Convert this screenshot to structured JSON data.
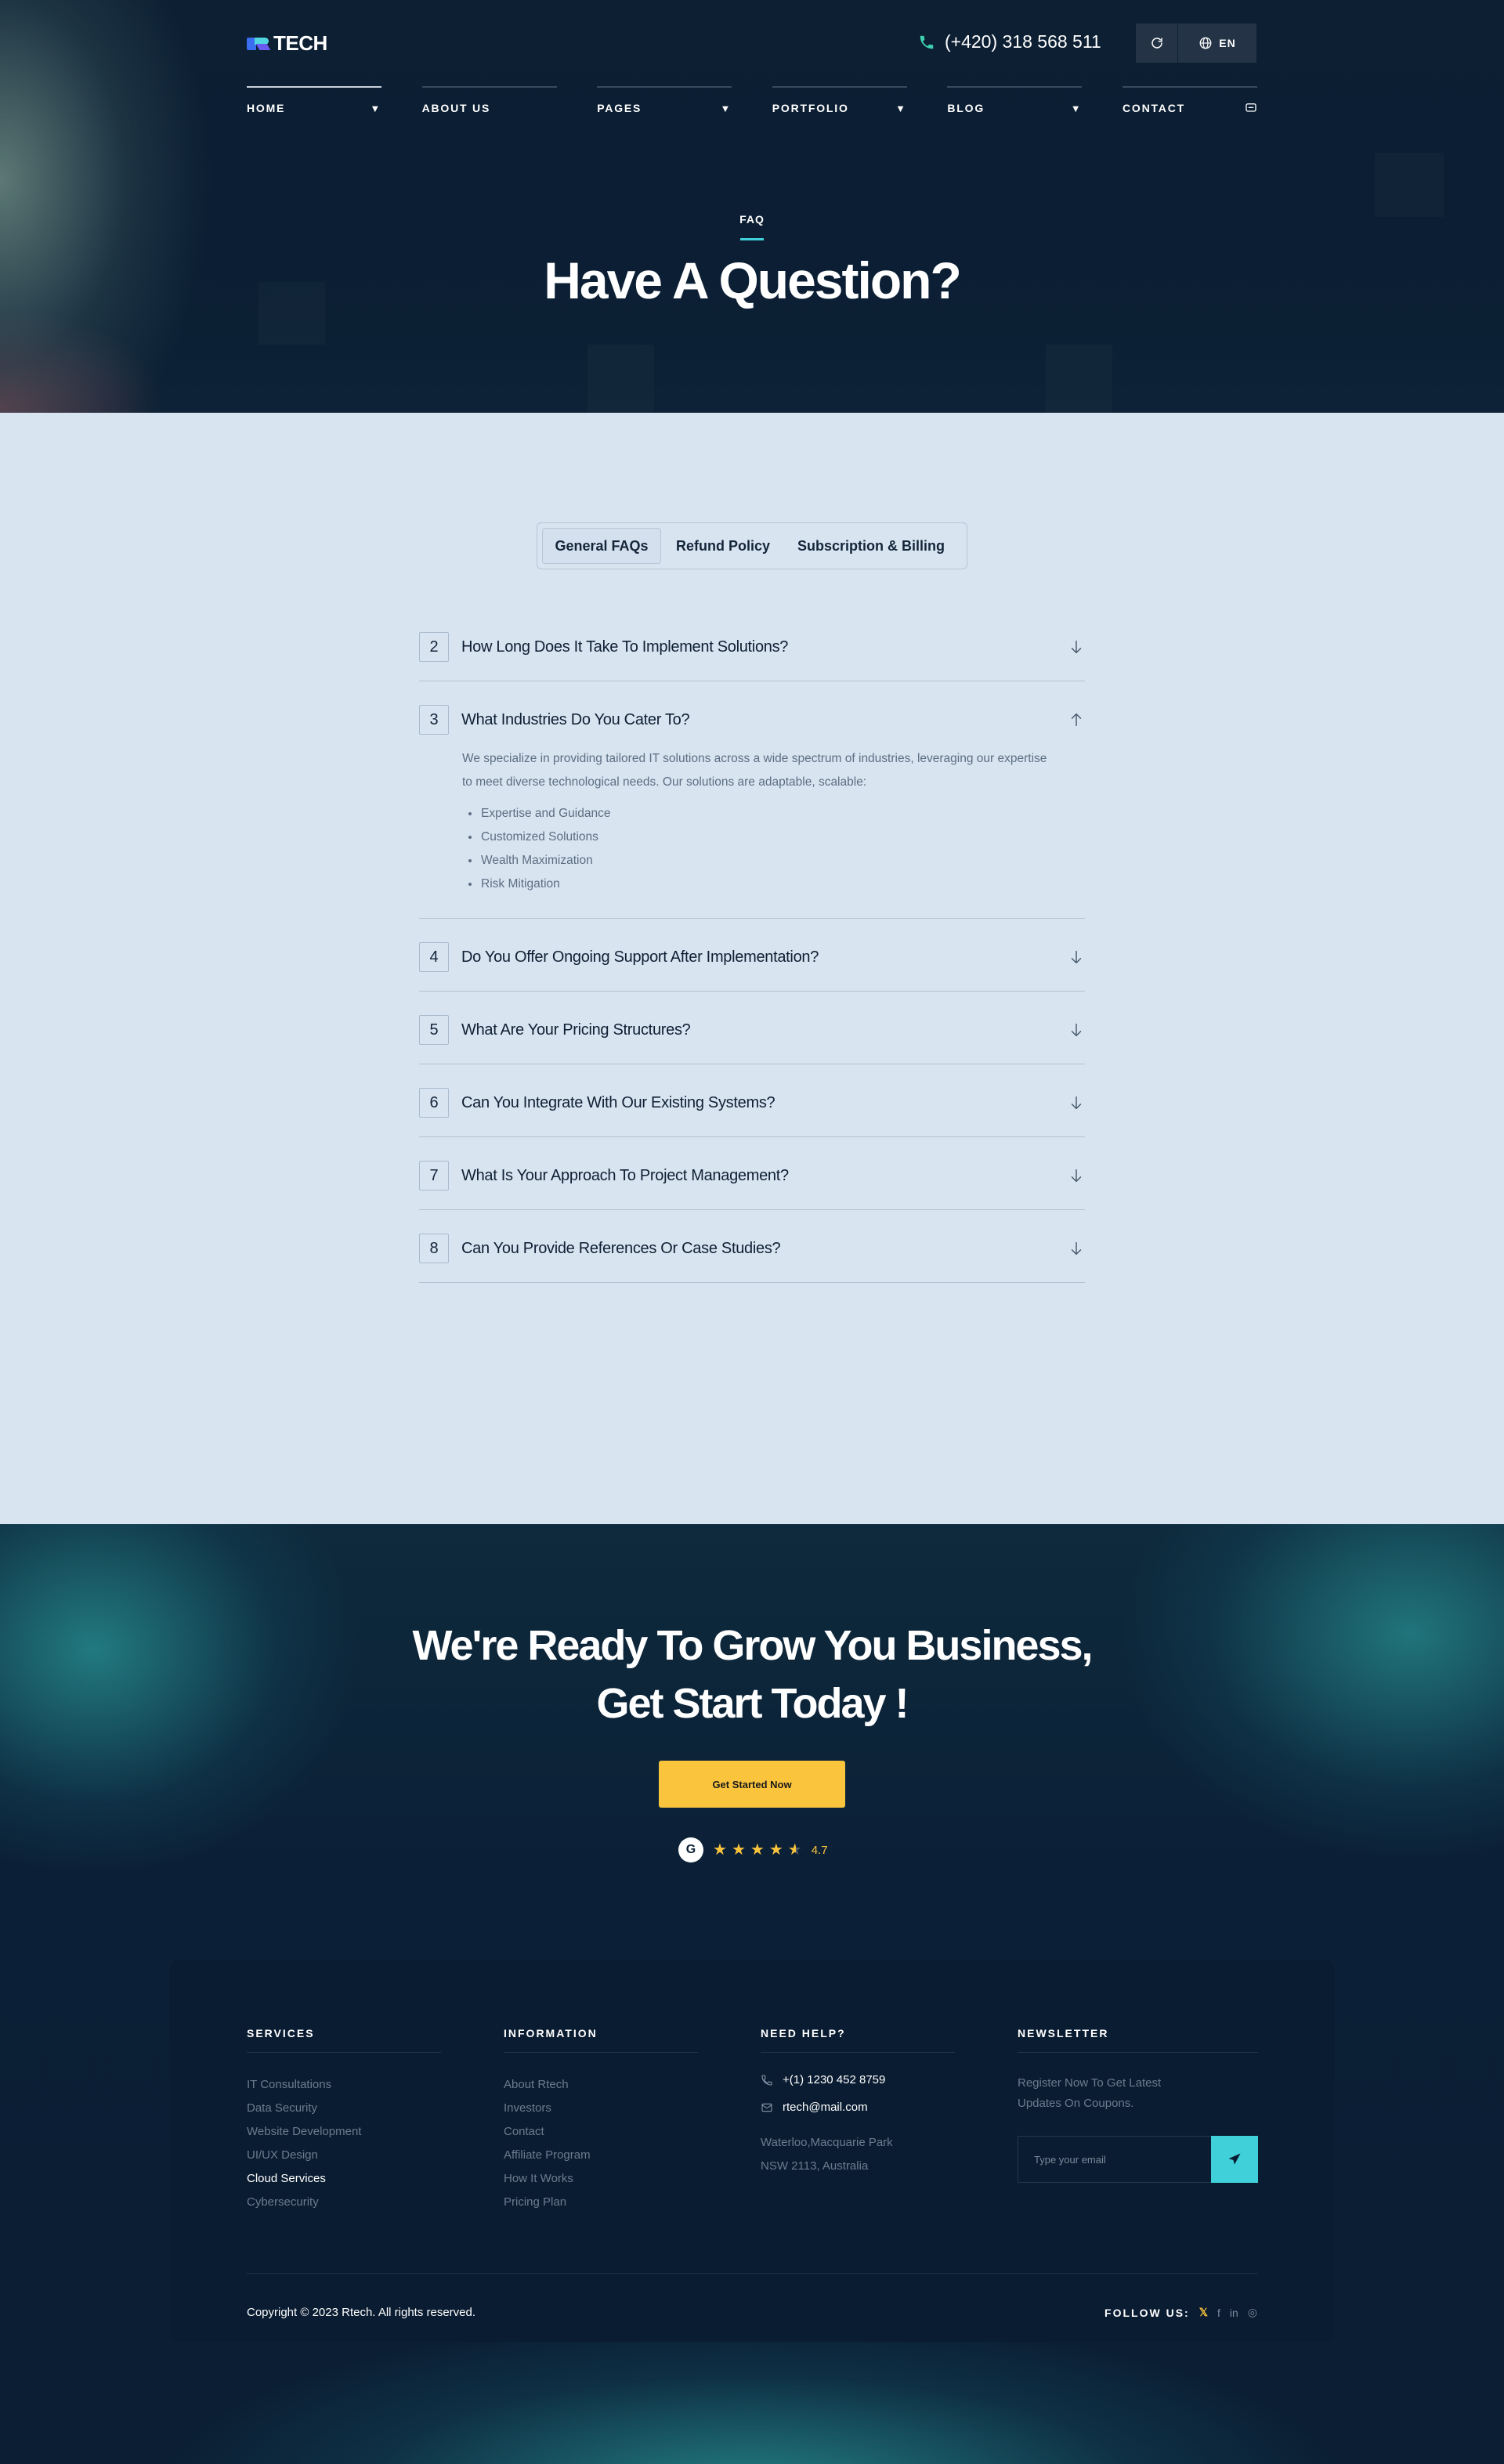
{
  "header": {
    "logo_text": "TECH",
    "phone": "(+420) 318 568 511",
    "lang": "EN"
  },
  "nav": [
    {
      "label": "HOME",
      "caret": "▼"
    },
    {
      "label": "ABOUT US",
      "caret": ""
    },
    {
      "label": "PAGES",
      "caret": "▼"
    },
    {
      "label": "PORTFOLIO",
      "caret": "▼"
    },
    {
      "label": "BLOG",
      "caret": "▼"
    },
    {
      "label": "CONTACT",
      "caret": ""
    }
  ],
  "hero": {
    "eyebrow": "FAQ",
    "title": "Have A Question?"
  },
  "faq": {
    "tabs": [
      "General FAQs",
      "Refund Policy",
      "Subscription & Billing"
    ],
    "items": [
      {
        "num": "2",
        "question": "How Long Does It Take To Implement Solutions?"
      },
      {
        "num": "3",
        "question": "What Industries Do You Cater To?",
        "answer": "We specialize in providing tailored IT solutions across a wide spectrum of industries, leveraging our expertise to meet diverse technological needs. Our solutions are adaptable, scalable:",
        "bullets": [
          "Expertise and Guidance",
          "Customized Solutions",
          "Wealth Maximization",
          "Risk Mitigation"
        ]
      },
      {
        "num": "4",
        "question": "Do You Offer Ongoing Support After Implementation?"
      },
      {
        "num": "5",
        "question": "What Are Your Pricing Structures?"
      },
      {
        "num": "6",
        "question": "Can You Integrate With Our Existing Systems?"
      },
      {
        "num": "7",
        "question": "What Is Your Approach To Project Management?"
      },
      {
        "num": "8",
        "question": "Can You Provide References Or Case Studies?"
      }
    ]
  },
  "cta": {
    "title_line1": "We're Ready To Grow You Business,",
    "title_line2": "Get Start Today !",
    "button": "Get Started Now",
    "rating": "4.7",
    "badge": "G"
  },
  "footer": {
    "services": {
      "title": "SERVICES",
      "items": [
        "IT Consultations",
        "Data Security",
        "Website Development",
        "UI/UX Design",
        "Cloud Services",
        "Cybersecurity"
      ]
    },
    "information": {
      "title": "INFORMATION",
      "items": [
        "About Rtech",
        "Investors",
        "Contact",
        "Affiliate Program",
        "How It Works",
        "Pricing Plan"
      ]
    },
    "help": {
      "title": "NEED HELP?",
      "phone": "+(1) 1230 452 8759",
      "email": "rtech@mail.com",
      "address_line1": "Waterloo,Macquarie Park",
      "address_line2": "NSW 2113, Australia"
    },
    "newsletter": {
      "title": "NEWSLETTER",
      "text": "Register Now To Get Latest Updates On Coupons.",
      "placeholder": "Type your email"
    },
    "copyright": "Copyright © 2023 Rtech. All rights reserved.",
    "follow_label": "FOLLOW US:",
    "social": {
      "x": "𝕏",
      "facebook": "f",
      "linkedin": "in",
      "instagram": "◎"
    }
  }
}
